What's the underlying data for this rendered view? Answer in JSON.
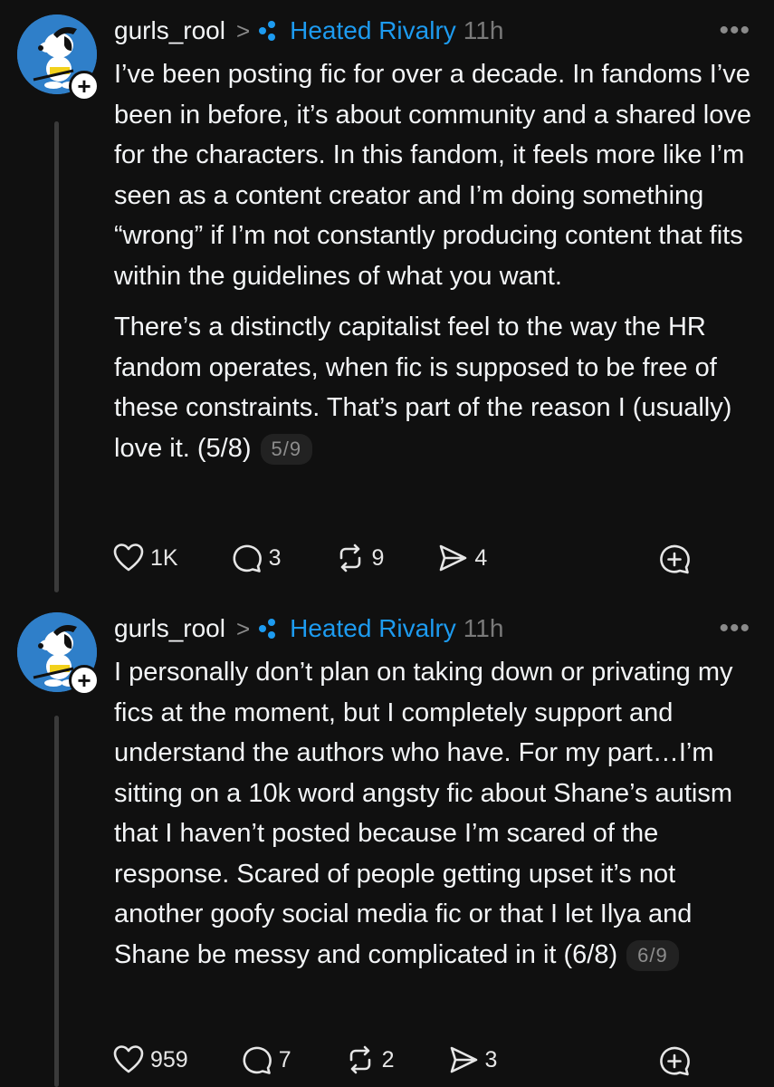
{
  "posts": [
    {
      "username": "gurls_rool",
      "tag": "Heated Rivalry",
      "time": "11h",
      "paragraphs": [
        "I’ve been posting fic for over a decade. In fandoms I’ve been in before, it’s about community and a shared love for the characters. In this fandom, it feels more like I’m seen as a content creator and I’m doing something “wrong” if I’m not constantly producing content that fits within the guidelines of what you want.",
        "There’s a distinctly capitalist feel to the way the HR fandom operates, when fic is supposed to be free of these constraints. That’s part of the reason I (usually) love it. (5/8)"
      ],
      "page_indicator": "5/9",
      "likes": "1K",
      "replies": "3",
      "reposts": "9",
      "shares": "4"
    },
    {
      "username": "gurls_rool",
      "tag": "Heated Rivalry",
      "time": "11h",
      "paragraphs": [
        "I personally don’t plan on taking down or privating my fics at the moment, but I completely support and understand the authors who have. For my part…I’m sitting on a 10k word angsty fic about Shane’s autism that I haven’t posted because I’m scared of the response. Scared of people getting upset it’s not another goofy social media fic or that I let Ilya and Shane be messy and complicated in it (6/8)"
      ],
      "page_indicator": "6/9",
      "likes": "959",
      "replies": "7",
      "reposts": "2",
      "shares": "3"
    }
  ],
  "icons": {
    "more": "more-horizontal-icon",
    "tag": "community-dots-icon",
    "like": "heart-icon",
    "reply": "comment-icon",
    "repost": "repost-icon",
    "share": "send-icon",
    "quote": "quote-plus-icon"
  },
  "colors": {
    "background": "#101010",
    "text": "#f3f5f7",
    "accent": "#1d9bf0",
    "muted": "#7a7a7a"
  }
}
